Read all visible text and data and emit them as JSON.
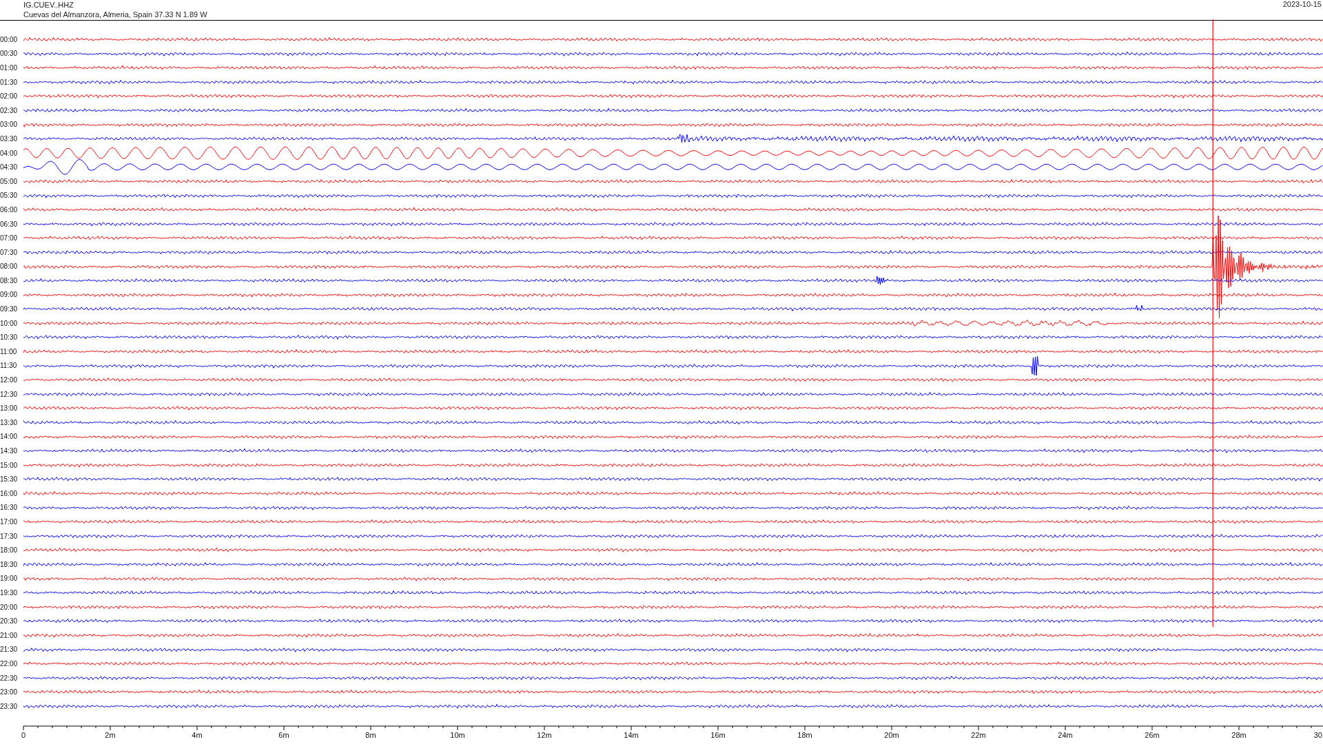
{
  "header": {
    "station": "IG.CUEV..HHZ",
    "location": "Cuevas del Almanzora, Almeria, Spain  37.33 N 1.89 W",
    "date": "2023-10-15"
  },
  "rows": [
    {
      "time": "00:00",
      "color": "#ff0000"
    },
    {
      "time": "00:30",
      "color": "#0000ff"
    },
    {
      "time": "01:00",
      "color": "#ff0000"
    },
    {
      "time": "01:30",
      "color": "#0000ff"
    },
    {
      "time": "02:00",
      "color": "#ff0000"
    },
    {
      "time": "02:30",
      "color": "#0000ff"
    },
    {
      "time": "03:00",
      "color": "#ff0000"
    },
    {
      "time": "03:30",
      "color": "#0000ff"
    },
    {
      "time": "04:00",
      "color": "#ff0000"
    },
    {
      "time": "04:30",
      "color": "#0000ff"
    },
    {
      "time": "05:00",
      "color": "#ff0000"
    },
    {
      "time": "05:30",
      "color": "#0000ff"
    },
    {
      "time": "06:00",
      "color": "#ff0000"
    },
    {
      "time": "06:30",
      "color": "#0000ff"
    },
    {
      "time": "07:00",
      "color": "#ff0000"
    },
    {
      "time": "07:30",
      "color": "#0000ff"
    },
    {
      "time": "08:00",
      "color": "#ff0000"
    },
    {
      "time": "08:30",
      "color": "#0000ff"
    },
    {
      "time": "09:00",
      "color": "#ff0000"
    },
    {
      "time": "09:30",
      "color": "#0000ff"
    },
    {
      "time": "10:00",
      "color": "#ff0000"
    },
    {
      "time": "10:30",
      "color": "#0000ff"
    },
    {
      "time": "11:00",
      "color": "#ff0000"
    },
    {
      "time": "11:30",
      "color": "#0000ff"
    },
    {
      "time": "12:00",
      "color": "#ff0000"
    },
    {
      "time": "12:30",
      "color": "#0000ff"
    },
    {
      "time": "13:00",
      "color": "#ff0000"
    },
    {
      "time": "13:30",
      "color": "#0000ff"
    },
    {
      "time": "14:00",
      "color": "#ff0000"
    },
    {
      "time": "14:30",
      "color": "#0000ff"
    },
    {
      "time": "15:00",
      "color": "#ff0000"
    },
    {
      "time": "15:30",
      "color": "#0000ff"
    },
    {
      "time": "16:00",
      "color": "#ff0000"
    },
    {
      "time": "16:30",
      "color": "#0000ff"
    },
    {
      "time": "17:00",
      "color": "#ff0000"
    },
    {
      "time": "17:30",
      "color": "#0000ff"
    },
    {
      "time": "18:00",
      "color": "#ff0000"
    },
    {
      "time": "18:30",
      "color": "#0000ff"
    },
    {
      "time": "19:00",
      "color": "#ff0000"
    },
    {
      "time": "19:30",
      "color": "#0000ff"
    },
    {
      "time": "20:00",
      "color": "#ff0000"
    },
    {
      "time": "20:30",
      "color": "#0000ff"
    },
    {
      "time": "21:00",
      "color": "#ff0000"
    },
    {
      "time": "21:30",
      "color": "#0000ff"
    },
    {
      "time": "22:00",
      "color": "#ff0000"
    },
    {
      "time": "22:30",
      "color": "#0000ff"
    },
    {
      "time": "23:00",
      "color": "#ff0000"
    },
    {
      "time": "23:30",
      "color": "#0000ff"
    }
  ],
  "x_axis": {
    "ticks": [
      "0",
      "2m",
      "4m",
      "6m",
      "8m",
      "10m",
      "12m",
      "14m",
      "16m",
      "18m",
      "20m",
      "22m",
      "24m",
      "26m",
      "28m",
      "30"
    ]
  }
}
